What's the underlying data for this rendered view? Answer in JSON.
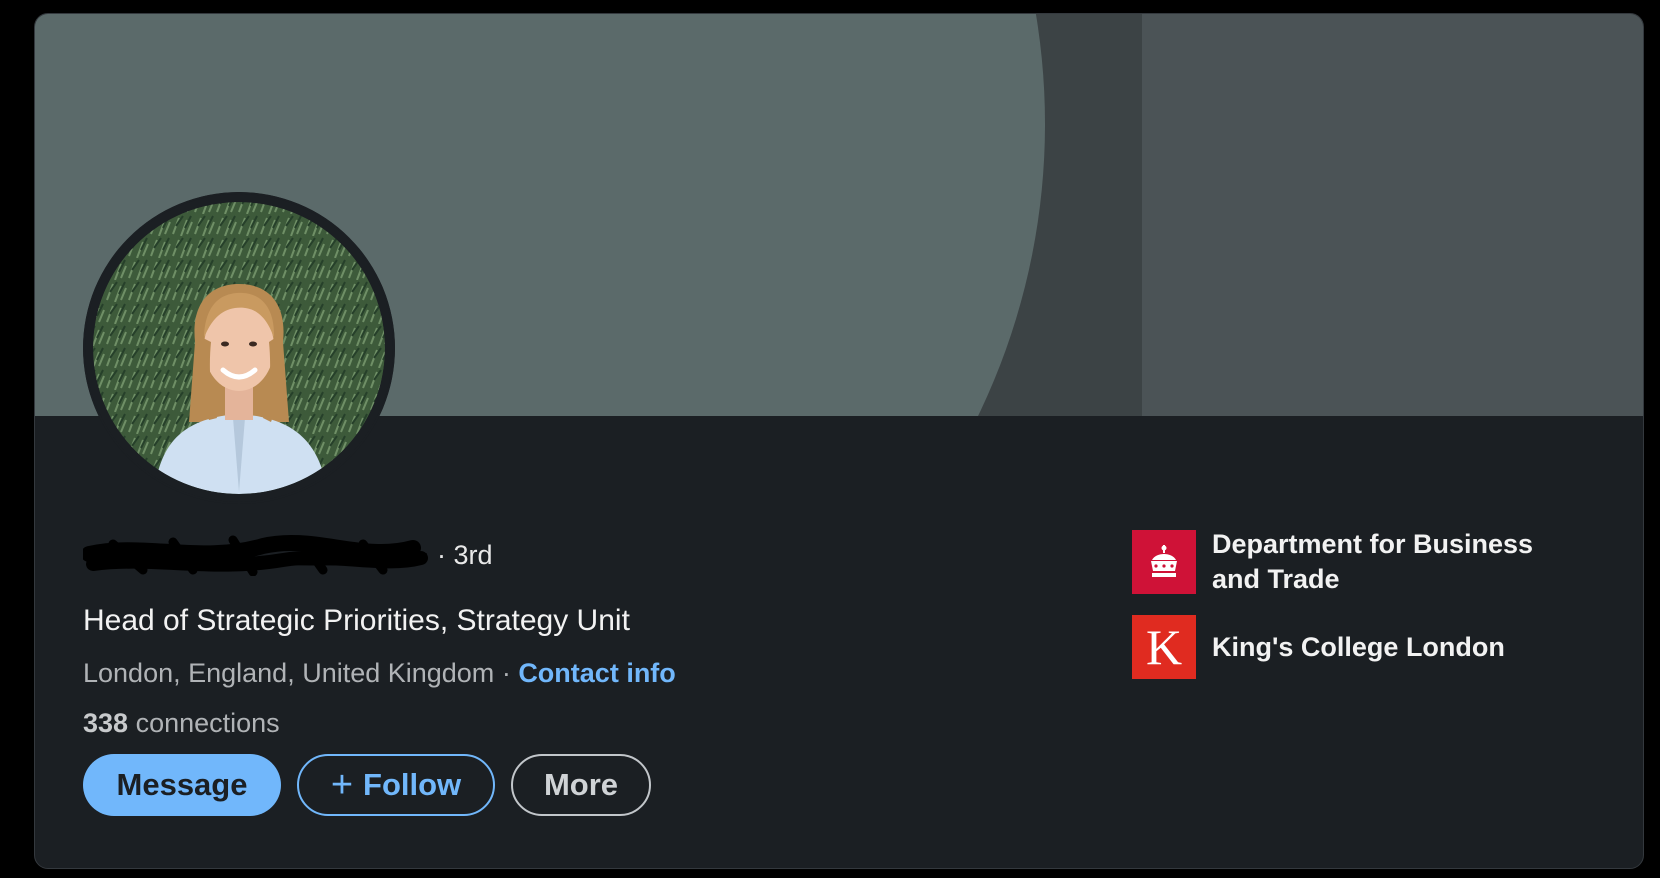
{
  "profile": {
    "name": "",
    "degree": "· 3rd",
    "headline": "Head of Strategic Priorities, Strategy Unit",
    "location": "London, England, United Kingdom",
    "separator": " · ",
    "contact_label": "Contact info",
    "connections_count": "338",
    "connections_label": " connections"
  },
  "actions": {
    "message_label": "Message",
    "follow_label": "Follow",
    "follow_icon": "+",
    "more_label": "More"
  },
  "organizations": [
    {
      "name": "Department for Business and Trade",
      "logo_icon": "crown-icon",
      "logo_color": "#cf1237"
    },
    {
      "name": "King's College London",
      "logo_letter": "K",
      "logo_color": "#e02b20"
    }
  ],
  "colors": {
    "accent": "#71b7fb",
    "background": "#1b1f23",
    "banner": "#5b6a6a"
  }
}
